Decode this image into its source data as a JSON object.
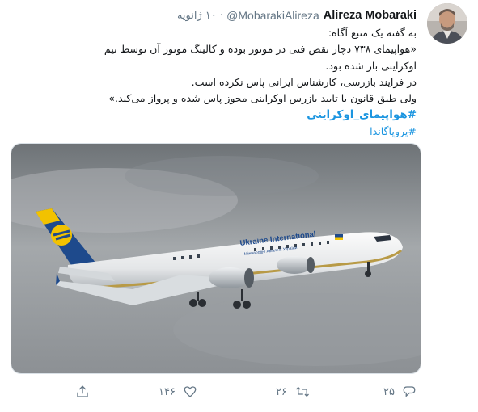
{
  "tweet": {
    "display_name": "Alireza Mobaraki",
    "handle": "@MobarakiAlireza",
    "separator": "·",
    "time": "۱۰ ژانویه",
    "lines": [
      "به گفته یک منبع آگاه:",
      "«هواپیمای ۷۳۸ دچار نقص فنی در موتور بوده و کالینگ موتور آن توسط تیم",
      "اوکراینی باز شده بود.",
      "در فرایند بازرسی، کارشناس ایرانی پاس نکرده است.",
      "ولی طبق قانون با تایید بازرس اوکراینی مجوز پاس شده و پرواز می‌کند.»"
    ],
    "hashtags": [
      "#هواپیمای_اوکراینی",
      "#پروپاگاندا"
    ],
    "media": {
      "livery_text": "Ukraine International",
      "livery_subtext": "Міжнародні Авіалінії України"
    },
    "actions": {
      "reply_count": "۲۵",
      "retweet_count": "۲۶",
      "like_count": "۱۴۶",
      "icons": [
        "reply-icon",
        "retweet-icon",
        "heart-icon",
        "share-icon"
      ]
    },
    "colors": {
      "link": "#1b95e0",
      "muted": "#657786",
      "text": "#14171a"
    }
  }
}
